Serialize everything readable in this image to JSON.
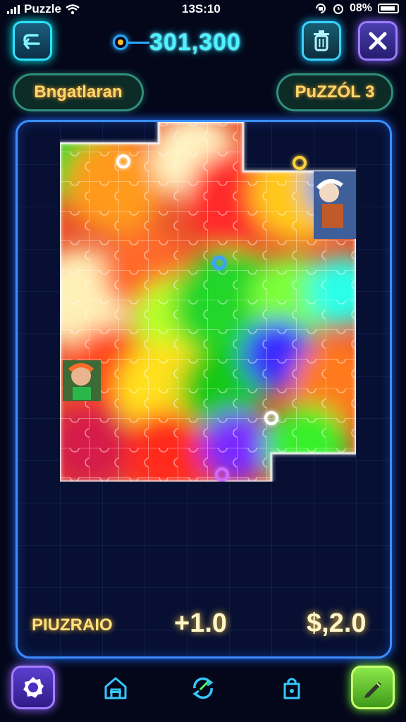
{
  "status_bar": {
    "carrier": "Puzzle",
    "time": "13S:10",
    "battery": "08%"
  },
  "header": {
    "score": "301,300"
  },
  "labels": {
    "left": "Bngatlaran",
    "right": "PuZZÓL 3"
  },
  "stats": {
    "label": "PIUZRAIO",
    "middle": "+1.0",
    "right": "$,2.0"
  },
  "icons": {
    "back": "back-arrow-icon",
    "trash": "trash-icon",
    "close": "close-icon",
    "settings": "settings-icon",
    "home": "home-icon",
    "shuffle": "shuffle-icon",
    "bag": "bag-icon",
    "edit": "pencil-icon"
  },
  "colors": {
    "neon_cyan": "#2ee0ff",
    "neon_purple": "#9a7dff",
    "neon_green": "#7dff3a",
    "label_gold": "#ffd76a",
    "board_border": "#3a8eff",
    "background": "#04071a"
  }
}
